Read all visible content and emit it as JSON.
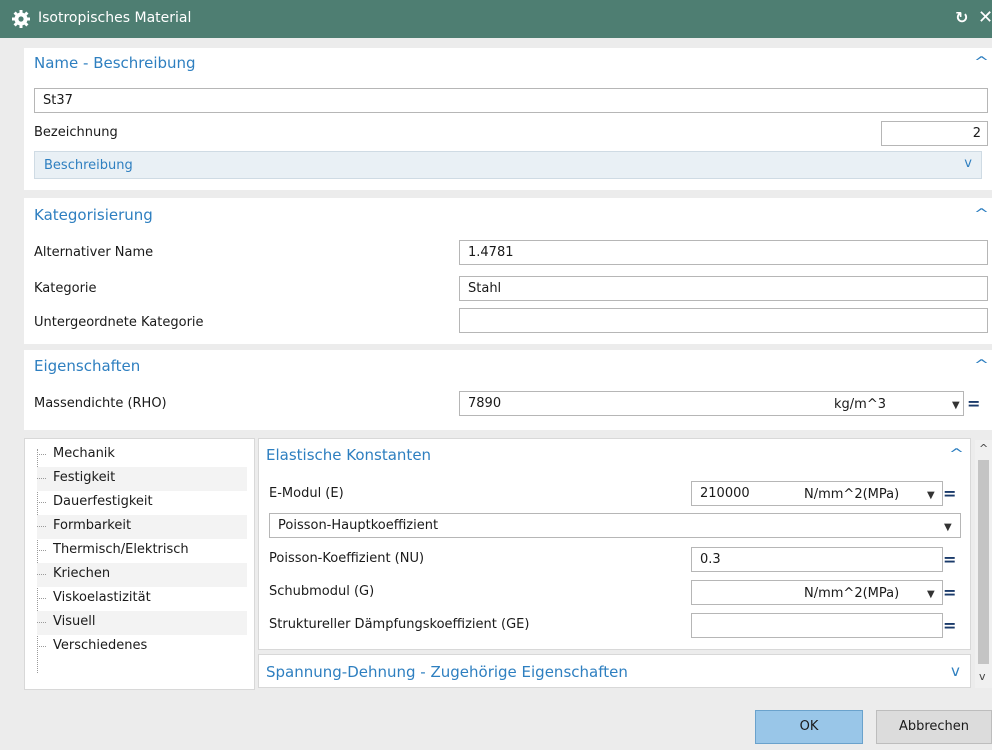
{
  "window": {
    "title": "Isotropisches Material"
  },
  "name_section": {
    "heading": "Name - Beschreibung",
    "name_value": "St37",
    "label_value": "Bezeichnung",
    "label_number": "2",
    "description_heading": "Beschreibung"
  },
  "category_section": {
    "heading": "Kategorisierung",
    "alt_name_label": "Alternativer Name",
    "alt_name_value": "1.4781",
    "category_label": "Kategorie",
    "category_value": "Stahl",
    "subcategory_label": "Untergeordnete Kategorie",
    "subcategory_value": ""
  },
  "properties_section": {
    "heading": "Eigenschaften",
    "density_label": "Massendichte (RHO)",
    "density_value": "7890",
    "density_unit": "kg/m^3"
  },
  "tree": {
    "items": [
      "Mechanik",
      "Festigkeit",
      "Dauerfestigkeit",
      "Formbarkeit",
      "Thermisch/Elektrisch",
      "Kriechen",
      "Viskoelastizität",
      "Visuell",
      "Verschiedenes"
    ]
  },
  "elastic": {
    "heading": "Elastische Konstanten",
    "emod_label": "E-Modul (E)",
    "emod_value": "210000",
    "emod_unit": "N/mm^2(MPa)",
    "poisson_select": "Poisson-Hauptkoeffizient",
    "nu_label": "Poisson-Koeffizient (NU)",
    "nu_value": "0.3",
    "shear_label": "Schubmodul (G)",
    "shear_value": "",
    "shear_unit": "N/mm^2(MPa)",
    "damping_label": "Struktureller Dämpfungskoeffizient (GE)",
    "damping_value": ""
  },
  "stress_strain": {
    "heading": "Spannung-Dehnung - Zugehörige Eigenschaften"
  },
  "buttons": {
    "ok": "OK",
    "cancel": "Abbrechen"
  },
  "icons": {
    "gear": "gear-icon",
    "reset": "reset-icon",
    "close": "close-icon",
    "expand": "chevron-up-icon",
    "collapse": "chevron-down-icon",
    "formula": "equals-icon",
    "dropdown": "triangle-down-icon"
  },
  "colors": {
    "titlebar": "#4e7e72",
    "accent": "#2e7fc0",
    "ok_button": "#99c6e8"
  }
}
